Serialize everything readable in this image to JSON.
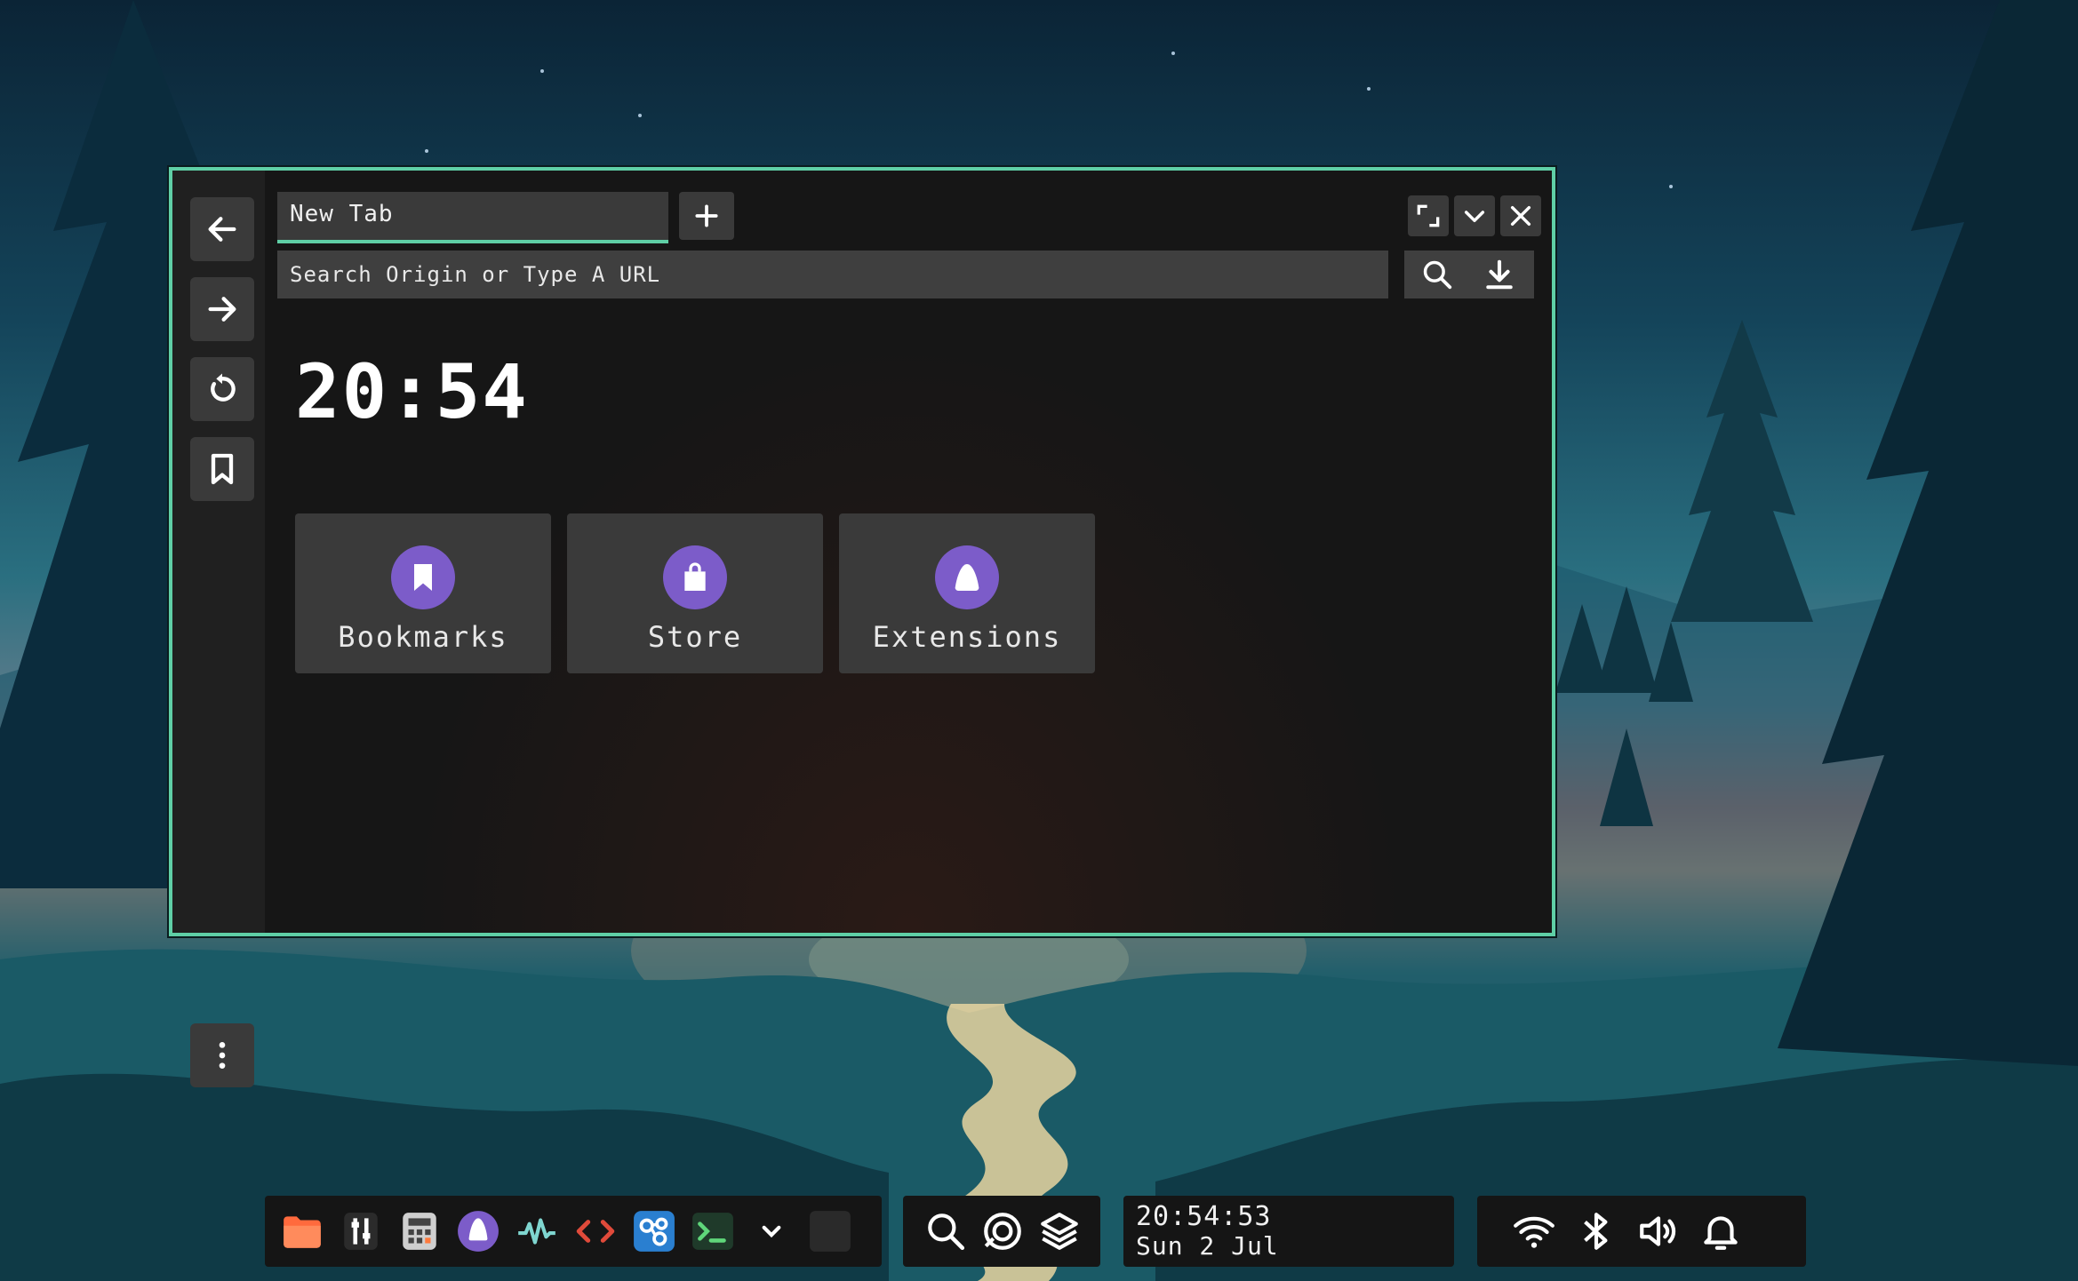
{
  "colors": {
    "accent": "#5fcfa6",
    "tile_icon": "#7c5cc9",
    "window_bg": "#161616",
    "panel_bg": "#151515",
    "button_bg": "#3a3a3a"
  },
  "browser": {
    "tab_title": "New Tab",
    "url_placeholder": "Search Origin or Type A URL",
    "clock": "20:54",
    "nav_icons": [
      "arrow-left-icon",
      "arrow-right-icon",
      "reload-icon",
      "bookmark-icon"
    ],
    "window_controls": [
      "maximize-icon",
      "chevron-down-icon",
      "close-icon"
    ],
    "tiles": [
      {
        "label": "Bookmarks",
        "icon": "bookmark-icon"
      },
      {
        "label": "Store",
        "icon": "shopping-bag-icon"
      },
      {
        "label": "Extensions",
        "icon": "puzzle-blob-icon"
      }
    ]
  },
  "taskbar": {
    "apps": [
      "files-icon",
      "settings-sliders-icon",
      "calculator-icon",
      "appstore-icon",
      "activity-monitor-icon",
      "code-editor-icon",
      "graph-icon",
      "terminal-icon",
      "chevron-down-icon",
      "blank-app-icon"
    ],
    "utilities": [
      "search-icon",
      "recent-icon",
      "layers-icon"
    ],
    "time": "20:54:53",
    "date": "Sun 2 Jul",
    "tray": [
      "wifi-icon",
      "bluetooth-icon",
      "volume-icon",
      "notification-bell-icon"
    ]
  }
}
